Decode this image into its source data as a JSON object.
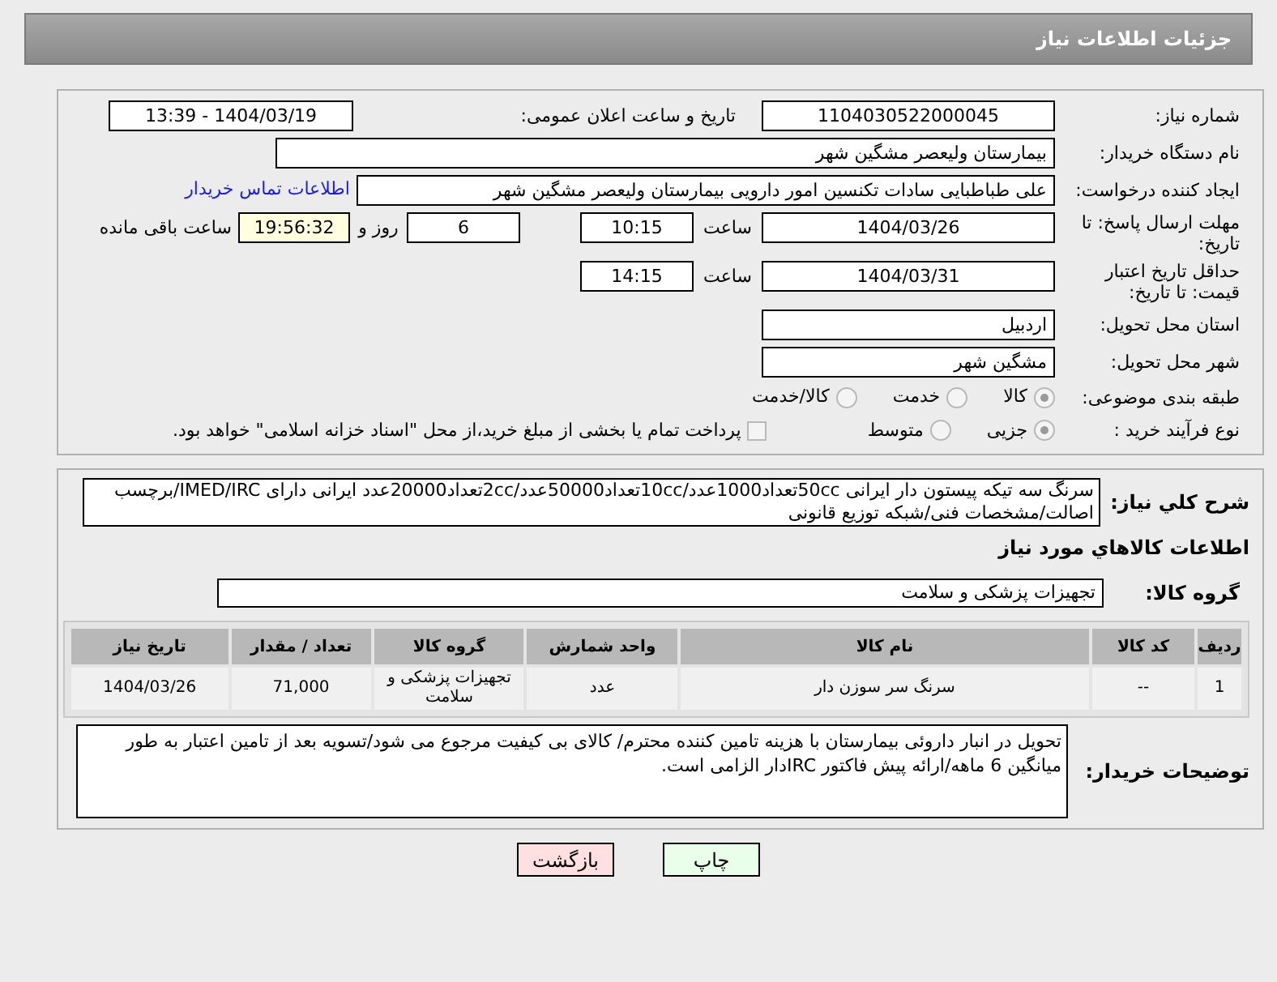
{
  "page_title": "جزئیات اطلاعات نیاز",
  "need_number": {
    "label": "شماره نیاز:",
    "value": "1104030522000045"
  },
  "announce": {
    "label": "تاریخ و ساعت اعلان عمومی:",
    "value": "1404/03/19 - 13:39"
  },
  "buyer_org": {
    "label": "نام دستگاه خریدار:",
    "value": "بیمارستان ولیعصر مشگین شهر"
  },
  "requester": {
    "label": "ایجاد کننده درخواست:",
    "value": "علی طباطبایی سادات تکنسین امور دارویی بیمارستان ولیعصر مشگین شهر",
    "link": "اطلاعات تماس خریدار"
  },
  "deadline": {
    "label": "مهلت ارسال پاسخ: تا تاریخ:",
    "date": "1404/03/26",
    "time_label": "ساعت",
    "time": "10:15",
    "days": "6",
    "days_label": "روز و",
    "remaining": "19:56:32",
    "remaining_label": "ساعت باقی مانده"
  },
  "price_validity": {
    "label": "حداقل تاریخ اعتبار قیمت: تا تاریخ:",
    "date": "1404/03/31",
    "time_label": "ساعت",
    "time": "14:15"
  },
  "province": {
    "label": "استان محل تحویل:",
    "value": "اردبیل"
  },
  "city": {
    "label": "شهر محل تحویل:",
    "value": "مشگین شهر"
  },
  "category": {
    "label": "طبقه بندی موضوعی:",
    "options": [
      {
        "label": "کالا",
        "selected": true
      },
      {
        "label": "خدمت",
        "selected": false
      },
      {
        "label": "کالا/خدمت",
        "selected": false
      }
    ]
  },
  "process": {
    "label": "نوع فرآیند خرید :",
    "options": [
      {
        "label": "جزیی",
        "selected": true
      },
      {
        "label": "متوسط",
        "selected": false
      }
    ],
    "payment_note": {
      "label": "پرداخت تمام یا بخشی از مبلغ خرید،از محل \"اسناد خزانه اسلامی\" خواهد بود.",
      "checked": false
    }
  },
  "description": {
    "label": "شرح کلي نياز:",
    "value": "سرنگ سه تیکه پیستون دار ایرانی 50ccتعداد1000عدد/10ccتعداد50000عدد/2ccتعداد20000عدد ایرانی دارای IMED/IRC/برچسب اصالت/مشخصات فنی/شبکه توزیع قانونی"
  },
  "goods_heading": "اطلاعات کالاهاي مورد نياز",
  "goods_group": {
    "label": "گروه کالا:",
    "value": "تجهیزات پزشکی و سلامت"
  },
  "table": {
    "columns": [
      "ردیف",
      "کد کالا",
      "نام کالا",
      "واحد شمارش",
      "گروه کالا",
      "تعداد / مقدار",
      "تاریخ نیاز"
    ],
    "rows": [
      [
        "1",
        "--",
        "سرنگ سر سوزن دار",
        "عدد",
        "تجهیزات پزشکی و سلامت",
        "71,000",
        "1404/03/26"
      ]
    ]
  },
  "buyer_notes": {
    "label": "توضیحات خریدار:",
    "value": "تحویل در انبار داروئی بیمارستان با هزینه تامین کننده محترم/ کالای بی کیفیت مرجوع می شود/تسویه بعد از تامین اعتبار به طور میانگین 6 ماهه/ارائه پیش فاکتور IRCدار الزامی است."
  },
  "buttons": [
    {
      "label": "چاپ",
      "kind": "print"
    },
    {
      "label": "بازگشت",
      "kind": "back"
    }
  ]
}
